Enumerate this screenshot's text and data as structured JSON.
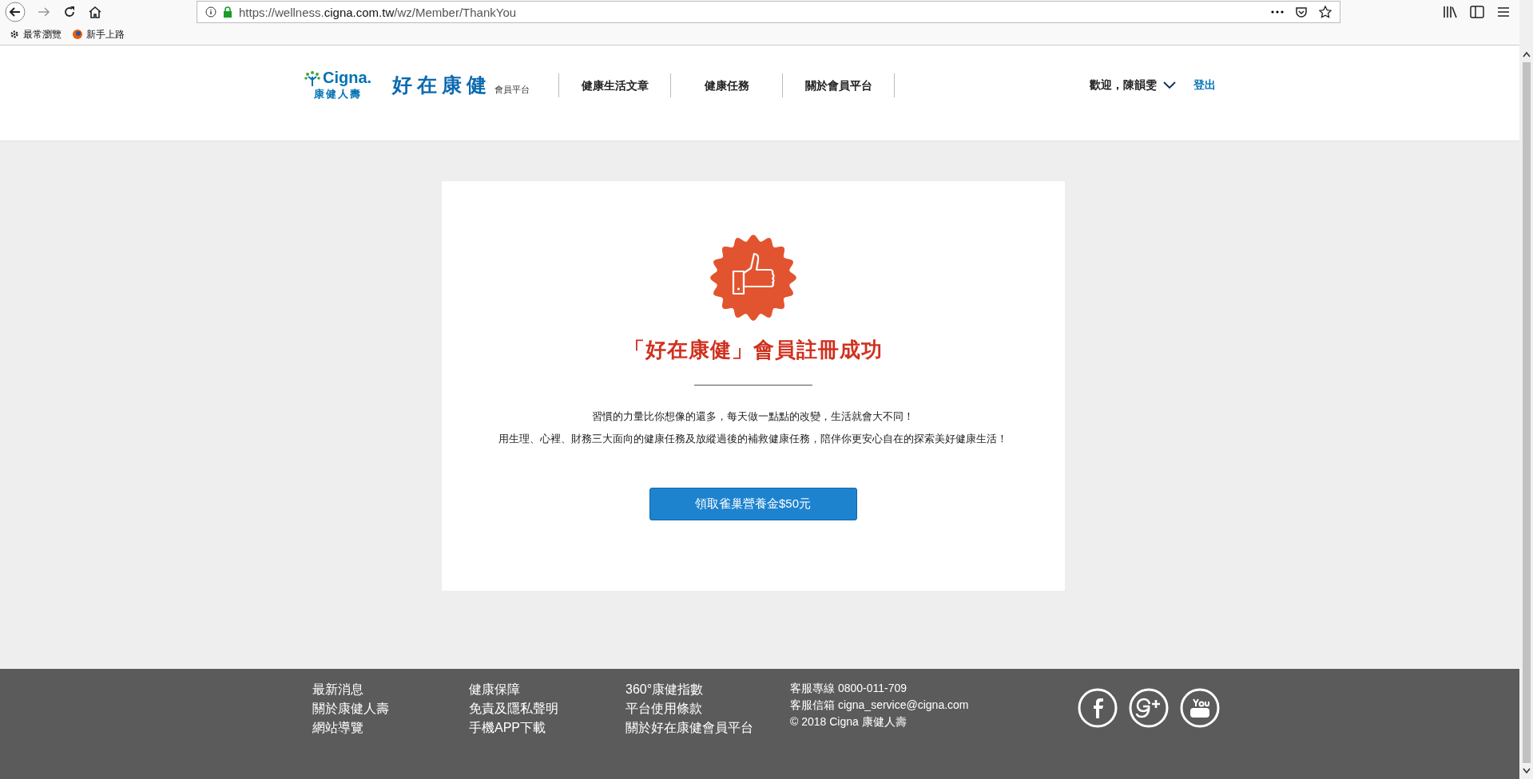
{
  "browser": {
    "url_prefix": "https://wellness.",
    "url_domain": "cigna.com.tw",
    "url_path": "/wz/Member/ThankYou",
    "bookmarks": [
      "最常瀏覽",
      "新手上路"
    ]
  },
  "header": {
    "logo_text": "Cigna.",
    "logo_sub": "康健人壽",
    "brand": "好在康健",
    "brand_sub": "會員平台",
    "nav": [
      {
        "label": "健康生活文章"
      },
      {
        "label": "健康任務"
      },
      {
        "label": "關於會員平台"
      }
    ],
    "welcome": "歡迎，陳韻雯",
    "logout": "登出"
  },
  "card": {
    "title": "「好在康健」會員註冊成功",
    "lines": [
      "習慣的力量比你想像的還多，每天做一點點的改變，生活就會大不同！",
      "用生理、心裡、財務三大面向的健康任務及放縱過後的補救健康任務，陪伴你更安心自在的探索美好健康生活！"
    ],
    "button": "領取雀巢營養金$50元"
  },
  "footer": {
    "columns": [
      [
        "最新消息",
        "關於康健人壽",
        "網站導覽"
      ],
      [
        "健康保障",
        "免責及隱私聲明",
        "手機APP下載"
      ],
      [
        "360°康健指數",
        "平台使用條款",
        "關於好在康健會員平台"
      ]
    ],
    "contact": [
      "客服專線 0800-011-709",
      "客服信箱 cigna_service@cigna.com",
      "© 2018 Cigna 康健人壽"
    ]
  }
}
